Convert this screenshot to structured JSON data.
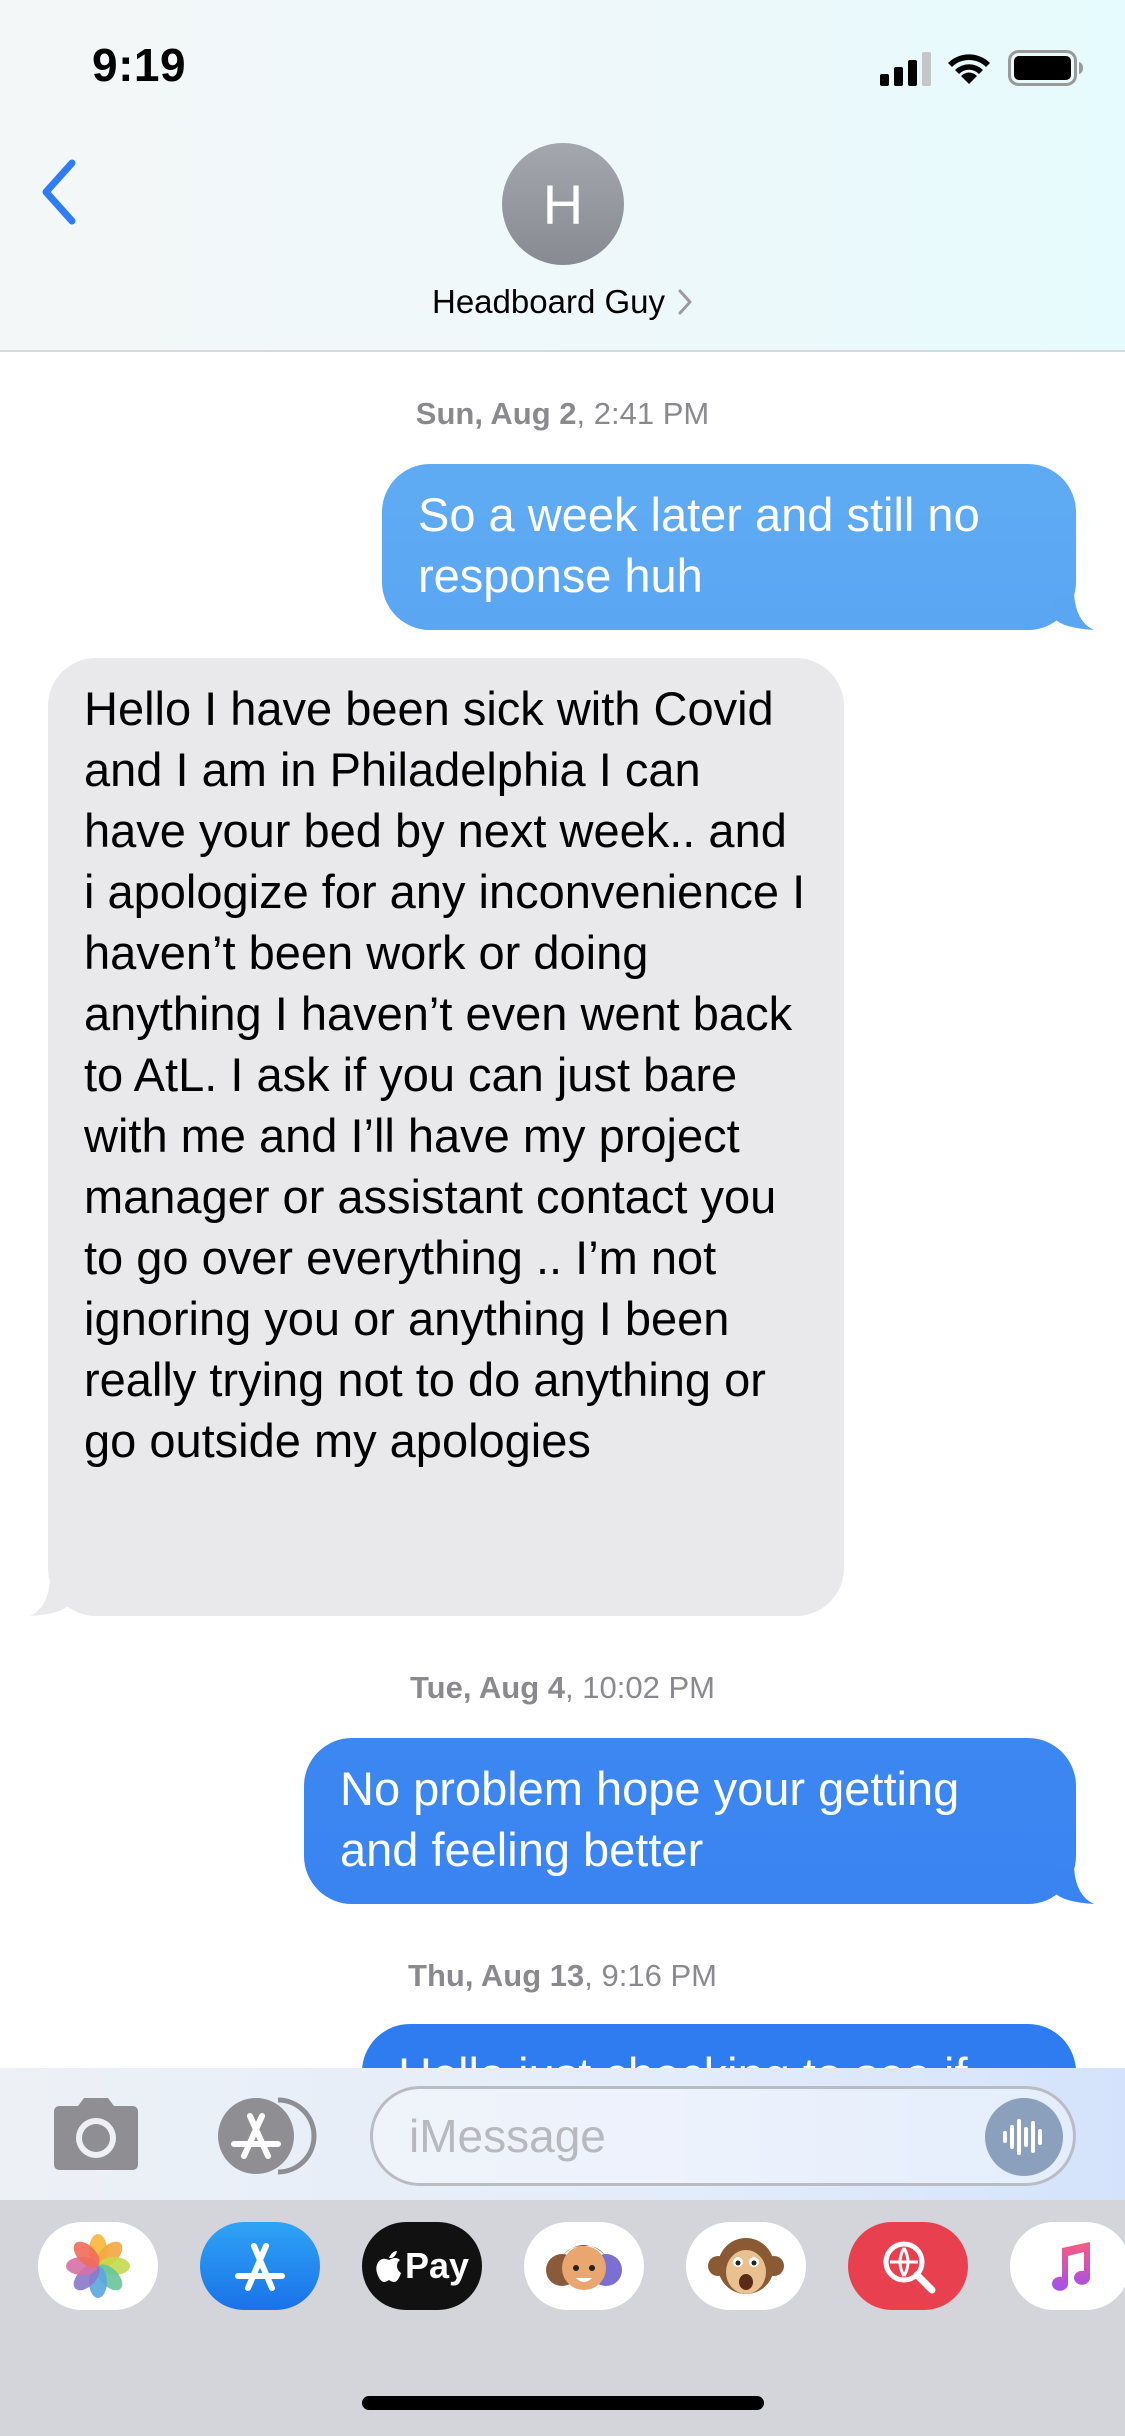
{
  "status_bar": {
    "time": "9:19"
  },
  "header": {
    "avatar_initial": "H",
    "contact_name": "Headboard Guy"
  },
  "conversation": {
    "items": [
      {
        "kind": "timestamp",
        "day": "Sun, Aug 2",
        "time": ", 2:41 PM"
      },
      {
        "kind": "message",
        "direction": "outgoing",
        "text": "So a week later and still no response huh"
      },
      {
        "kind": "message",
        "direction": "incoming",
        "text": "Hello I have been sick with Covid and I am in Philadelphia I can have your bed by next week.. and i apologize for any inconvenience I haven’t been work or doing anything I haven’t even went back to AtL. I ask if you can just bare with me and I’ll have my project manager or assistant contact you to go over everything .. I’m not ignoring you or anything I been really trying not to do anything or go outside my apologies"
      },
      {
        "kind": "timestamp",
        "day": "Tue, Aug 4",
        "time": ", 10:02 PM"
      },
      {
        "kind": "message",
        "direction": "outgoing",
        "text": "No problem hope your getting and feeling better"
      },
      {
        "kind": "timestamp",
        "day": "Thu, Aug 13",
        "time": ", 9:16 PM"
      },
      {
        "kind": "message",
        "direction": "outgoing",
        "text": "Hello just checking to see if"
      }
    ]
  },
  "input_bar": {
    "placeholder": "iMessage"
  },
  "app_drawer": {
    "apps": [
      {
        "name": "photos-icon"
      },
      {
        "name": "app-store-icon"
      },
      {
        "name": "apple-pay-icon",
        "label": "Pay"
      },
      {
        "name": "memoji-icon"
      },
      {
        "name": "animoji-monkey-icon"
      },
      {
        "name": "web-images-search-icon"
      },
      {
        "name": "music-icon"
      }
    ]
  },
  "colors": {
    "outgoing_bubble_top": "#5ea9f2",
    "outgoing_bubble_bottom": "#2d7bf0",
    "incoming_bubble": "#e9e9eb",
    "back_chevron": "#2f7cf6",
    "timestamp_text": "#8a8a8e"
  }
}
